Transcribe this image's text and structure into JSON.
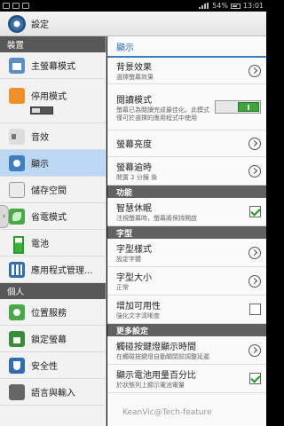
{
  "status_bar": {
    "time": "13:01",
    "battery_percent": "54%"
  },
  "action_bar": {
    "title": "設定"
  },
  "left_menu": {
    "section_device": "裝置",
    "home_mode": "主螢幕模式",
    "power_saving_label": "停用模式",
    "sound": "音效",
    "display": "顯示",
    "storage": "儲存空間",
    "eco_mode": "省電模式",
    "battery": "電池",
    "app_manager": "應用程式管理...",
    "section_personal": "個人",
    "location": "位置服務",
    "lock_screen": "鎖定螢幕",
    "security": "安全性",
    "language": "語言與輸入"
  },
  "right_panel": {
    "header": "顯示",
    "background_title": "背景效果",
    "background_sub": "選擇螢幕效果",
    "reading_title": "閱讀模式",
    "reading_sub": "螢幕已為閱讀完成最佳化。此模式僅可於選擇的應用程式中使用",
    "brightness_title": "螢幕亮度",
    "timeout_title": "螢幕逾時",
    "timeout_sub": "閒置 2 分鐘 後",
    "section_function": "功能",
    "smart_stay_title": "智慧休眠",
    "smart_stay_sub": "注視螢幕時，螢幕將保持開啟",
    "section_font": "字型",
    "font_style_title": "字型樣式",
    "font_style_sub": "設定字體",
    "font_size_title": "字型大小",
    "font_size_sub": "正常",
    "readability_title": "增加可用性",
    "readability_sub": "強化文字清晰度",
    "section_more": "更多設定",
    "touch_key_title": "觸碰按鍵燈顯示時間",
    "touch_key_sub": "在觸碰按鍵燈自動關閉前調整延遲",
    "battery_pct_title": "顯示電池用量百分比",
    "battery_pct_sub": "於狀態列上顯示電池電量"
  },
  "watermark": "KeanVic@Tech-feature",
  "colors": {
    "accent": "#2f6eb3",
    "selected": "#bcd8f4",
    "toggle_on": "#3fa43f"
  }
}
